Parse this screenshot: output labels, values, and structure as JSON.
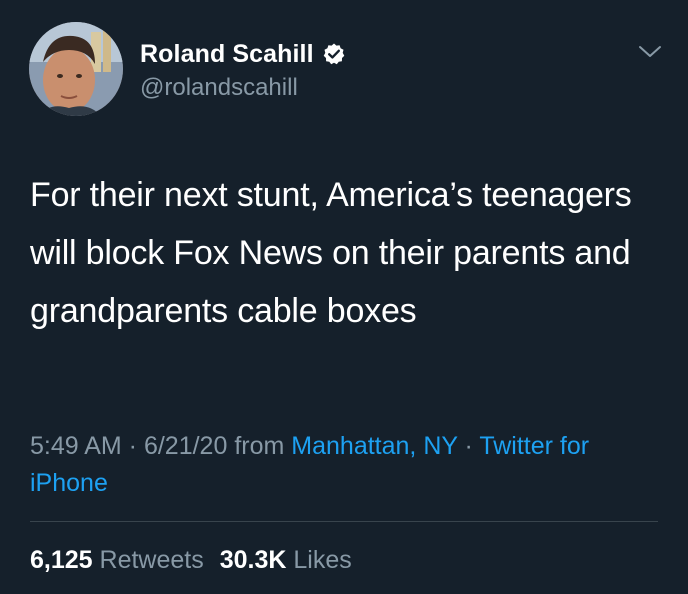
{
  "author": {
    "display_name": "Roland Scahill",
    "handle": "@rolandscahill",
    "verified_icon": "verified-badge-icon",
    "avatar_icon": "profile-photo"
  },
  "tweet": {
    "text": "For their next stunt, America’s teenagers will block Fox News on their parents and grandparents cable boxes"
  },
  "meta": {
    "time": "5:49 AM",
    "separator1": " · ",
    "date": "6/21/20",
    "from_label": " from ",
    "location": "Manhattan, NY",
    "separator2": " · ",
    "source": "Twitter for iPhone"
  },
  "stats": {
    "retweets_count": "6,125",
    "retweets_label": "Retweets",
    "likes_count": "30.3K",
    "likes_label": "Likes"
  },
  "colors": {
    "background": "#15202b",
    "primary_text": "#ffffff",
    "secondary_text": "#8899a6",
    "link": "#1da1f2",
    "divider": "#38444d"
  },
  "menu_icon": "chevron-down-icon"
}
